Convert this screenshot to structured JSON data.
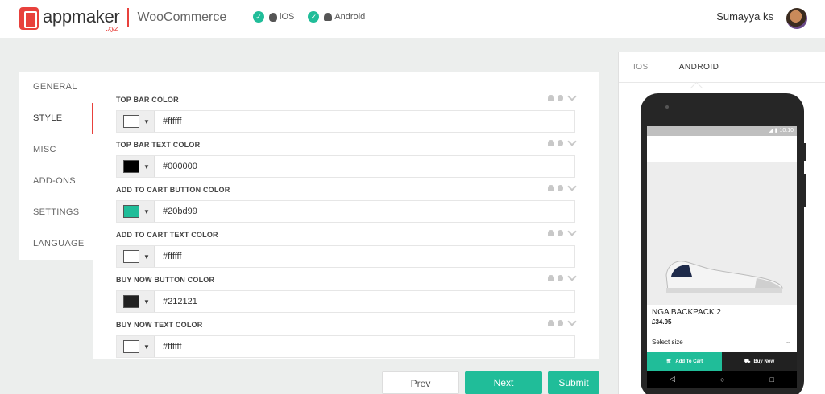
{
  "header": {
    "logo_text": "appmaker",
    "logo_sub": ".xyz",
    "platform": "WooCommerce",
    "badges": [
      {
        "label": "iOS",
        "icon": "apple-icon"
      },
      {
        "label": "Android",
        "icon": "android-icon"
      }
    ],
    "user_name": "Sumayya ks"
  },
  "sidenav": {
    "items": [
      {
        "label": "GENERAL"
      },
      {
        "label": "STYLE",
        "active": true
      },
      {
        "label": "MISC"
      },
      {
        "label": "ADD-ONS"
      },
      {
        "label": "SETTINGS"
      },
      {
        "label": "LANGUAGE"
      }
    ]
  },
  "fields": [
    {
      "label": "TOP BAR COLOR",
      "value": "#ffffff",
      "color": "#ffffff"
    },
    {
      "label": "TOP BAR TEXT COLOR",
      "value": "#000000",
      "color": "#000000"
    },
    {
      "label": "ADD TO CART BUTTON COLOR",
      "value": "#20bd99",
      "color": "#20bd99"
    },
    {
      "label": "ADD TO CART TEXT COLOR",
      "value": "#ffffff",
      "color": "#ffffff"
    },
    {
      "label": "BUY NOW BUTTON COLOR",
      "value": "#212121",
      "color": "#212121"
    },
    {
      "label": "BUY NOW TEXT COLOR",
      "value": "#ffffff",
      "color": "#ffffff"
    }
  ],
  "buttons": {
    "prev": "Prev",
    "next": "Next",
    "submit": "Submit"
  },
  "preview": {
    "tabs": [
      "IOS",
      "ANDROID"
    ],
    "active_tab": "ANDROID",
    "status_time": "10:10",
    "product_name": "NGA BACKPACK 2",
    "product_price": "£34.95",
    "select_size": "Select size",
    "add_to_cart": "Add To Cart",
    "buy_now": "Buy Now"
  },
  "colors": {
    "accent": "#20bd99",
    "brand": "#e8413c",
    "dark": "#212121"
  }
}
